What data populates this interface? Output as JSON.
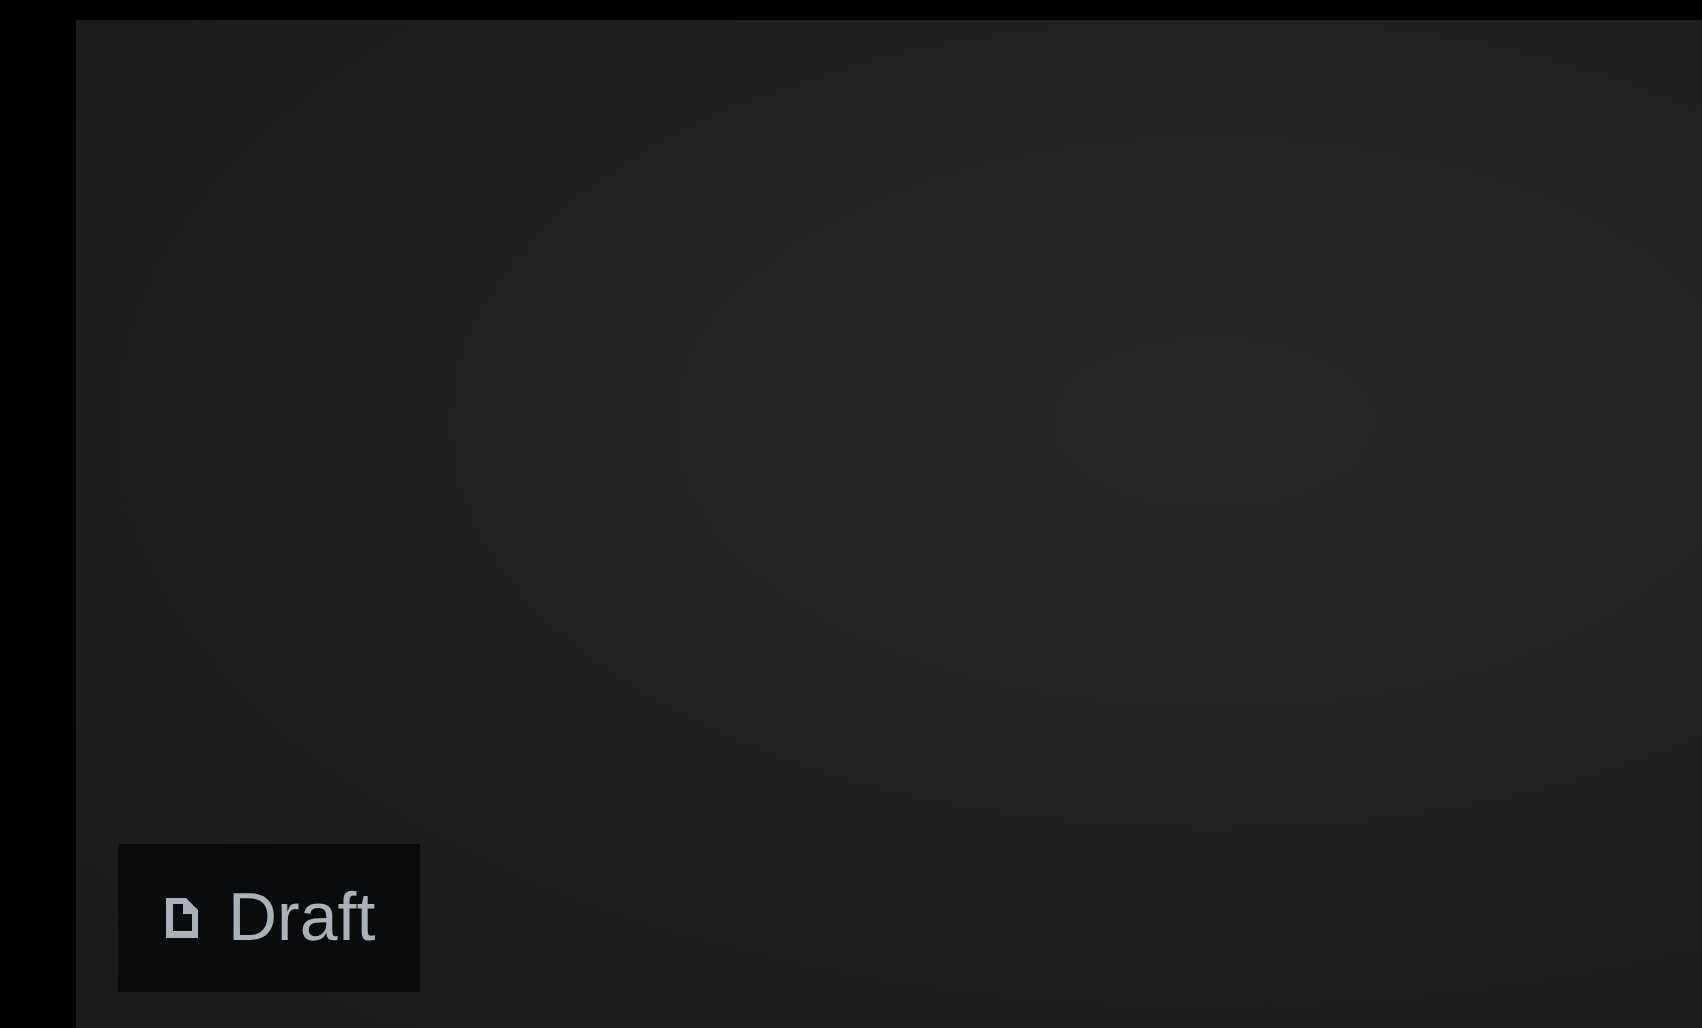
{
  "status_badge": {
    "label": "Draft"
  }
}
